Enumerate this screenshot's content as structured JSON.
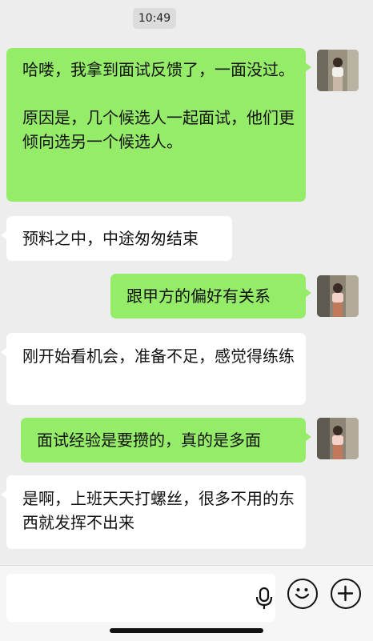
{
  "timestamp": "10:49",
  "messages": [
    {
      "side": "out",
      "text": "哈喽，我拿到面试反馈了，一面没过。\n\n原因是，几个候选人一起面试，他们更倾向选另一个候选人。"
    },
    {
      "side": "in",
      "text": "预料之中，中途匆匆结束"
    },
    {
      "side": "out",
      "text": "跟甲方的偏好有关系"
    },
    {
      "side": "in",
      "text": "刚开始看机会，准备不足，感觉得练练"
    },
    {
      "side": "out",
      "text": "面试经验是要攒的，真的是多面"
    },
    {
      "side": "in",
      "text": "是啊，上班天天打螺丝，很多不用的东西就发挥不出来"
    }
  ],
  "input": {
    "value": "",
    "placeholder": ""
  },
  "icons": {
    "voice": "microphone-icon",
    "emoji": "emoji-icon",
    "more": "plus-icon"
  },
  "colors": {
    "outgoing_bubble": "#95ec69",
    "incoming_bubble": "#ffffff",
    "background": "#ededed"
  }
}
